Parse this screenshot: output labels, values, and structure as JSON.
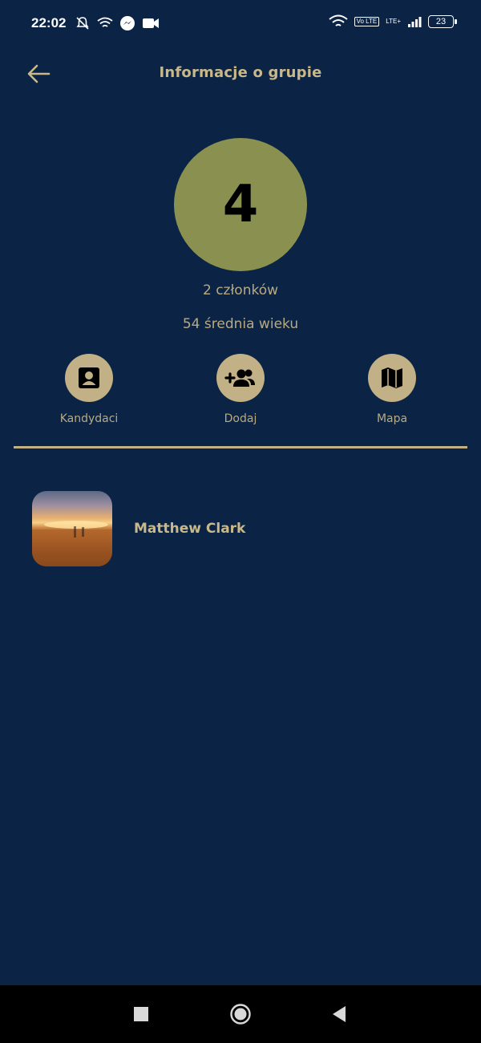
{
  "status_bar": {
    "time": "22:02",
    "lte_badge": "Vo LTE",
    "lte_text": "LTE+",
    "battery": "23"
  },
  "header": {
    "title": "Informacje o grupie",
    "back_icon": "arrow-left-icon"
  },
  "group": {
    "number": "4",
    "members": "2 członków",
    "avg_age": "54 średnia wieku"
  },
  "actions": [
    {
      "label": "Kandydaci",
      "icon": "contact-card-icon"
    },
    {
      "label": "Dodaj",
      "icon": "add-group-icon"
    },
    {
      "label": "Mapa",
      "icon": "map-icon"
    }
  ],
  "members": [
    {
      "name": "Matthew Clark"
    }
  ],
  "colors": {
    "background": "#0b2344",
    "accent": "#c2b086",
    "circle": "#8a9150"
  }
}
